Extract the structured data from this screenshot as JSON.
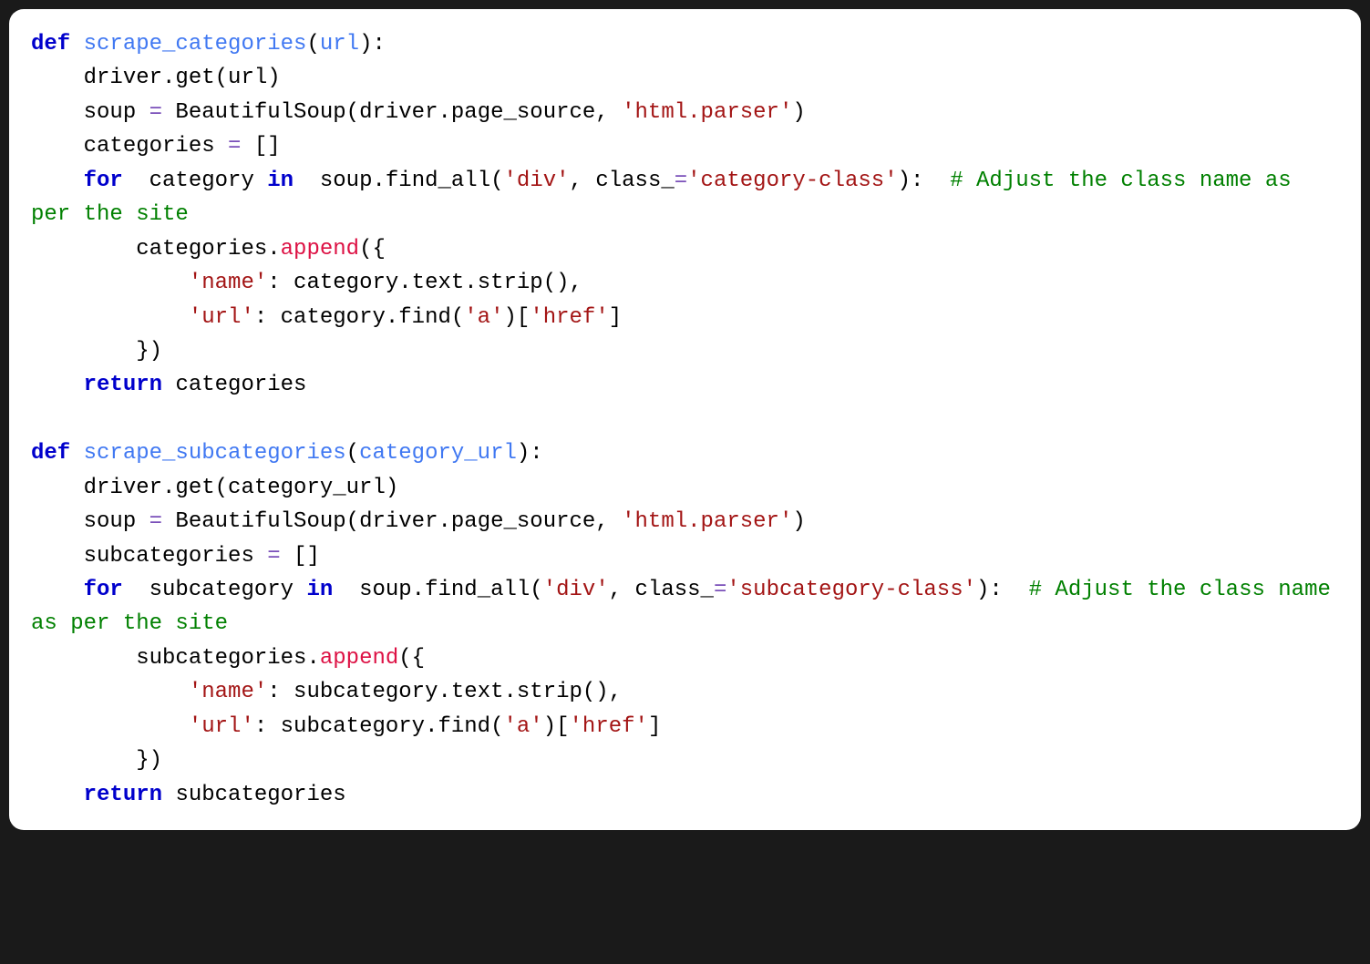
{
  "code": {
    "lines": [
      {
        "type": "def1",
        "tokens": [
          "def ",
          "scrape_categories",
          "(",
          "url",
          "):"
        ]
      },
      {
        "type": "body",
        "indent": 1,
        "tokens": [
          "driver.get(url)"
        ]
      },
      {
        "type": "body",
        "indent": 1,
        "tokens": [
          "soup ",
          "= ",
          "BeautifulSoup(driver.page_source, ",
          "'html.parser'",
          ")"
        ]
      },
      {
        "type": "body",
        "indent": 1,
        "tokens": [
          "categories ",
          "= ",
          "[]"
        ]
      },
      {
        "type": "for1",
        "indent": 1,
        "tokens": [
          "for ",
          "category ",
          "in ",
          "soup.find_all(",
          "'div'",
          ", class_",
          "=",
          "'category-class'",
          "):  ",
          "# Adjust the class name as per the site"
        ]
      },
      {
        "type": "body",
        "indent": 2,
        "tokens": [
          "categories.",
          "append",
          "({"
        ]
      },
      {
        "type": "body",
        "indent": 3,
        "tokens": [
          "'name'",
          ": category.text.strip(),"
        ]
      },
      {
        "type": "body",
        "indent": 3,
        "tokens": [
          "'url'",
          ": category.find(",
          "'a'",
          ")[",
          "'href'",
          "]"
        ]
      },
      {
        "type": "body",
        "indent": 2,
        "tokens": [
          "})"
        ]
      },
      {
        "type": "return",
        "indent": 1,
        "tokens": [
          "return ",
          "categories"
        ]
      },
      {
        "type": "blank"
      },
      {
        "type": "def2",
        "tokens": [
          "def ",
          "scrape_subcategories",
          "(",
          "category_url",
          "):"
        ]
      },
      {
        "type": "body",
        "indent": 1,
        "tokens": [
          "driver.get(category_url)"
        ]
      },
      {
        "type": "body",
        "indent": 1,
        "tokens": [
          "soup ",
          "= ",
          "BeautifulSoup(driver.page_source, ",
          "'html.parser'",
          ")"
        ]
      },
      {
        "type": "body",
        "indent": 1,
        "tokens": [
          "subcategories ",
          "= ",
          "[]"
        ]
      },
      {
        "type": "for2",
        "indent": 1,
        "tokens": [
          "for ",
          "subcategory ",
          "in ",
          "soup.find_all(",
          "'div'",
          ", class_",
          "=",
          "'subcategory-class'",
          "):  ",
          "# Adjust the class name as per the site"
        ]
      },
      {
        "type": "body",
        "indent": 2,
        "tokens": [
          "subcategories.",
          "append",
          "({"
        ]
      },
      {
        "type": "body",
        "indent": 3,
        "tokens": [
          "'name'",
          ": subcategory.text.strip(),"
        ]
      },
      {
        "type": "body",
        "indent": 3,
        "tokens": [
          "'url'",
          ": subcategory.find(",
          "'a'",
          ")[",
          "'href'",
          "]"
        ]
      },
      {
        "type": "body",
        "indent": 2,
        "tokens": [
          "})"
        ]
      },
      {
        "type": "return",
        "indent": 1,
        "tokens": [
          "return ",
          "subcategories"
        ]
      }
    ]
  },
  "t": {
    "def": "def ",
    "for": "for ",
    "in": "in ",
    "return": "return ",
    "fn1": "scrape_categories",
    "fn2": "scrape_subcategories",
    "p1": "url",
    "p2": "category_url",
    "l1a": "    driver.get(url)",
    "l2a": "    soup ",
    "l2b": "=",
    "l2c": " BeautifulSoup(driver.page_source, ",
    "l2d": "'html.parser'",
    "l2e": ")",
    "l3a": "    categories ",
    "l3b": "=",
    "l3c": " []",
    "l4a": "    ",
    "l4b": " category ",
    "l4c": " soup.find_all(",
    "l4d": "'div'",
    "l4e": ", class_",
    "l4f": "=",
    "l4g": "'category-class'",
    "l4h": "):  ",
    "l4i": "# Adjust the class name as per the site",
    "l5a": "        categories.",
    "l5b": "append",
    "l5c": "({",
    "l6a": "            ",
    "l6b": "'name'",
    "l6c": ": category.text.strip(),",
    "l7a": "            ",
    "l7b": "'url'",
    "l7c": ": category.find(",
    "l7d": "'a'",
    "l7e": ")[",
    "l7f": "'href'",
    "l7g": "]",
    "l8a": "        })",
    "l9a": "    ",
    "l9b": "categories",
    "b1a": "    driver.get(category_url)",
    "b2a": "    soup ",
    "b2d": "'html.parser'",
    "b3a": "    subcategories ",
    "b3c": " []",
    "b4b": " subcategory ",
    "b4g": "'subcategory-class'",
    "b4i": "# Adjust the class name as per the site",
    "b5a": "        subcategories.",
    "b6c": ": subcategory.text.strip(),",
    "b7c": ": subcategory.find(",
    "b9b": "subcategories"
  }
}
